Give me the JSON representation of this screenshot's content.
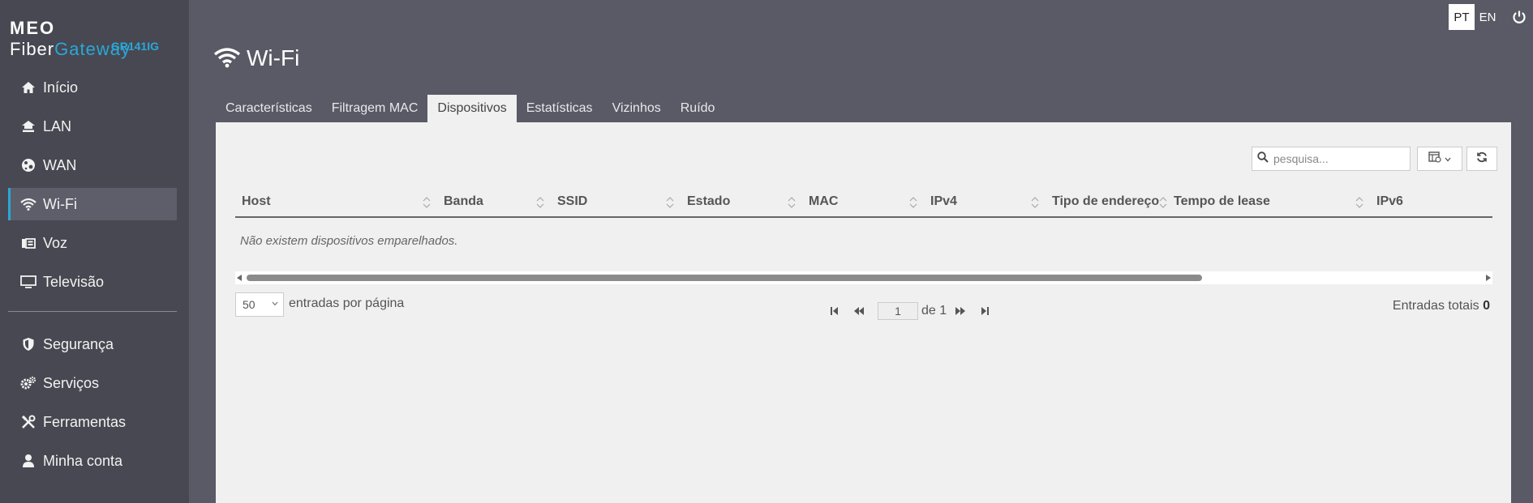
{
  "brand": {
    "meo": "MEO",
    "fiber": "Fiber",
    "gateway": "Gateway",
    "model": "GR141IG"
  },
  "language": {
    "pt": "PT",
    "en": "EN",
    "active": "PT"
  },
  "sidebar": {
    "items": [
      {
        "label": "Início",
        "icon": "home-icon"
      },
      {
        "label": "LAN",
        "icon": "lan-icon"
      },
      {
        "label": "WAN",
        "icon": "globe-icon"
      },
      {
        "label": "Wi-Fi",
        "icon": "wifi-icon",
        "active": true
      },
      {
        "label": "Voz",
        "icon": "phone-icon"
      },
      {
        "label": "Televisão",
        "icon": "tv-icon"
      }
    ],
    "items2": [
      {
        "label": "Segurança",
        "icon": "shield-icon"
      },
      {
        "label": "Serviços",
        "icon": "gears-icon"
      },
      {
        "label": "Ferramentas",
        "icon": "tools-icon"
      },
      {
        "label": "Minha conta",
        "icon": "user-icon"
      }
    ]
  },
  "page": {
    "title": "Wi-Fi"
  },
  "tabs": [
    {
      "label": "Características"
    },
    {
      "label": "Filtragem MAC"
    },
    {
      "label": "Dispositivos",
      "active": true
    },
    {
      "label": "Estatísticas"
    },
    {
      "label": "Vizinhos"
    },
    {
      "label": "Ruído"
    }
  ],
  "toolbar": {
    "search_placeholder": "pesquisa..."
  },
  "table": {
    "columns": [
      "Host",
      "Banda",
      "SSID",
      "Estado",
      "MAC",
      "IPv4",
      "Tipo de endereço",
      "Tempo de lease",
      "IPv6"
    ],
    "empty_message": "Não existem dispositivos emparelhados."
  },
  "pagination": {
    "page_size": "50",
    "page_size_label": "entradas por página",
    "current_page": "1",
    "of_label": "de 1",
    "total_label": "Entradas totais",
    "total_count": "0"
  },
  "colors": {
    "accent": "#29a8d8",
    "sidebar": "#484852",
    "header": "#5a5a66",
    "panel": "#f0f0f0"
  }
}
